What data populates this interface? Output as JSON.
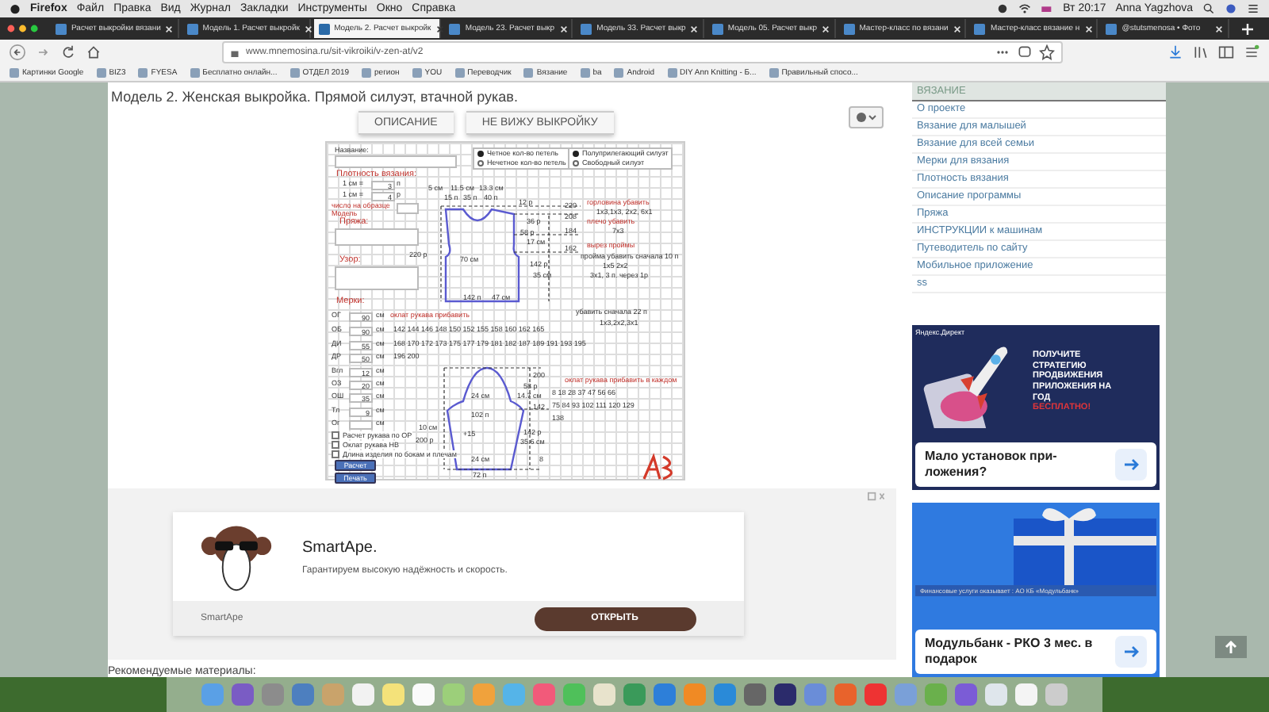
{
  "menubar": {
    "app": "Firefox",
    "items": [
      "Файл",
      "Правка",
      "Вид",
      "Журнал",
      "Закладки",
      "Инструменты",
      "Окно",
      "Справка"
    ],
    "clock": "Вт 20:17",
    "user": "Anna Yagzhova"
  },
  "tabs": [
    {
      "label": "Расчет выкройки вязани",
      "selected": false
    },
    {
      "label": "Модель 1. Расчет выкройк",
      "selected": false
    },
    {
      "label": "Модель 2. Расчет выкройк",
      "selected": true
    },
    {
      "label": "Модель 23. Расчет выкр",
      "selected": false
    },
    {
      "label": "Модель 33. Расчет выкр",
      "selected": false
    },
    {
      "label": "Модель 05. Расчет выкр",
      "selected": false
    },
    {
      "label": "Мастер-класс по вязани",
      "selected": false
    },
    {
      "label": "Мастер-класс вязание н",
      "selected": false
    },
    {
      "label": "@stutsmenosa • Фото",
      "selected": false
    }
  ],
  "address_bar": {
    "url": "www.mnemosina.ru/sit-vikroiki/v-zen-at/v2"
  },
  "bookmarks": [
    "Картинки Google",
    "BIZ3",
    "FYESA",
    "Бесплатно онлайн...",
    "ОТДЕЛ 2019",
    "регион",
    "YOU",
    "Переводчик",
    "Вязание",
    "ba",
    "Android",
    "DIY Ann Knitting - Б...",
    "Правильный спосо..."
  ],
  "page": {
    "title": "Модель 2. Женская выкройка. Прямой силуэт, втачной рукав.",
    "buttons": [
      "ОПИСАНИЕ",
      "НЕ ВИЖУ ВЫКРОЙКУ"
    ],
    "pattern": {
      "name_label": "Название:",
      "options_left": [
        {
          "label": "Четное кол-во петель",
          "selected": true
        },
        {
          "label": "Нечетное кол-во петель",
          "selected": false
        }
      ],
      "options_right": [
        {
          "label": "Полуприлегающий силуэт",
          "selected": true
        },
        {
          "label": "Свободный силуэт",
          "selected": false
        }
      ],
      "gauge_title": "Плотность вязания:",
      "gauge": [
        {
          "label": "1 см =",
          "value": "3",
          "unit": "п"
        },
        {
          "label": "1 см =",
          "value": "4",
          "unit": "р"
        }
      ],
      "gauge_note": "число на образце",
      "model_label": "Модель",
      "yarn_label": "Пряжа:",
      "stitch_label": "Узор:",
      "measures_label": "Мерки:",
      "measures": [
        {
          "code": "ОГ",
          "value": "90",
          "unit": "см"
        },
        {
          "code": "ОБ",
          "value": "90",
          "unit": "см"
        },
        {
          "code": "ДИ",
          "value": "55",
          "unit": "см"
        },
        {
          "code": "ДР",
          "value": "50",
          "unit": "см"
        },
        {
          "code": "Вгл",
          "value": "12",
          "unit": "см"
        },
        {
          "code": "ОЗ",
          "value": "20",
          "unit": "см"
        },
        {
          "code": "ОШ",
          "value": "35",
          "unit": "см"
        },
        {
          "code": "Тл",
          "value": "9",
          "unit": "см"
        },
        {
          "code": "Ог",
          "unit": "см"
        }
      ],
      "rows_heading": "оклат рукава прибавить",
      "rows": [
        "142 144 146 148 150 152 155 158 160 162 165",
        "168 170 172 173 175 177 179 181 182 187 189 191 193 195",
        "196 200"
      ],
      "body_labels": [
        "5 см",
        "11.5 см",
        "13.3 см",
        "15 п",
        "35 п",
        "40 п",
        "12 р",
        "220",
        "208",
        "184",
        "162",
        "36 р",
        "58 р",
        "17 см",
        "220 р",
        "70 см",
        "142 р",
        "35 см",
        "142 п",
        "47 см"
      ],
      "sleeve_labels": [
        "200",
        "58 р",
        "14.7 см",
        "142",
        "24 см",
        "102 п",
        "10 см",
        "200 р",
        "+15",
        "142 р",
        "35.6 см",
        "8",
        "24 см",
        "72 п"
      ],
      "notes": [
        {
          "kind": "heading",
          "text": "горловина убавить"
        },
        {
          "kind": "value",
          "text": "1х3,1х3, 2х2, 6х1"
        },
        {
          "kind": "heading",
          "text": "плечо убавить"
        },
        {
          "kind": "value",
          "text": "7х3"
        },
        {
          "kind": "heading",
          "text": "вырез проймы"
        },
        {
          "kind": "value",
          "text": "пройма убавить сначала 10 п"
        },
        {
          "kind": "value",
          "text": "1х5 2х2"
        },
        {
          "kind": "value",
          "text": "3х1, 3 п. через 1р"
        },
        {
          "kind": "value",
          "text": "убавить сначала 22 п"
        },
        {
          "kind": "value",
          "text": "1х3,2х2,3х1"
        },
        {
          "kind": "heading",
          "text": "оклат рукава прибавить в каждом"
        }
      ],
      "sleeve_counts": [
        "8 18 28 37 47 56 66",
        "75 84 93 102 111 120 129",
        "138"
      ],
      "checks": [
        {
          "label": "Расчет рукава по ОР",
          "checked": false
        },
        {
          "label": "Оклат рукава НВ",
          "checked": false
        },
        {
          "label": "Длина изделия по бокам и плечам",
          "checked": false
        }
      ],
      "actions": [
        "Расчет",
        "Печать"
      ]
    },
    "ad": {
      "title": "SmartApe.",
      "text": "Гарантируем высокую надёжность и скорость.",
      "brand": "SmartApe",
      "button": "ОТКРЫТЬ"
    },
    "recommended": "Рекомендуемые материалы:"
  },
  "sidebar": {
    "header": "ВЯЗАНИЕ",
    "items": [
      "О проекте",
      "Вязание для малышей",
      "Вязание для всей семьи",
      "Мерки для вязания",
      "Плотность вязания",
      "Описание программы",
      "Пряжа",
      "ИНСТРУКЦИИ к машинам",
      "Путеводитель по сайту",
      "Мобильное приложение",
      "ss"
    ]
  },
  "sidebar_ads": [
    {
      "kind": "rocket",
      "label": "Яндекс.Директ",
      "headline": "ПОЛУЧИТЕ СТРАТЕГИЮ ПРОДВИЖЕНИЯ ПРИЛОЖЕНИЯ НА ГОД",
      "highlight": "БЕСПЛАТНО!",
      "text": "Мало установок при-ложения?"
    },
    {
      "kind": "gift",
      "label": "Финансовые услуги оказывает : АО КБ «Модульбанк»",
      "text": "Модульбанк - РКО 3 мес. в подарок"
    }
  ]
}
